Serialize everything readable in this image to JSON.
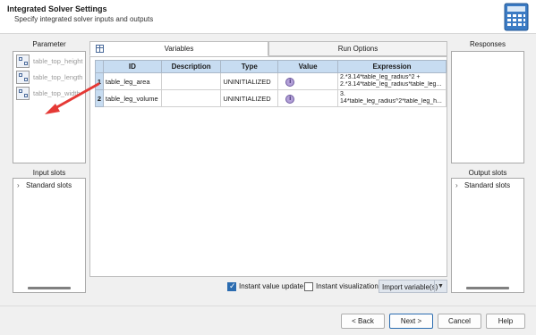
{
  "header": {
    "title": "Integrated Solver Settings",
    "subtitle": "Specify integrated solver inputs and outputs",
    "icon": "calculator-icon"
  },
  "parameter_panel": {
    "title": "Parameter",
    "items": [
      {
        "label": "table_top_height"
      },
      {
        "label": "table_top_length"
      },
      {
        "label": "table_top_width"
      }
    ]
  },
  "input_slots": {
    "title": "Input slots",
    "items": [
      {
        "label": "Standard slots"
      }
    ]
  },
  "responses_panel": {
    "title": "Responses"
  },
  "output_slots": {
    "title": "Output slots",
    "items": [
      {
        "label": "Standard slots"
      }
    ]
  },
  "tabs": [
    {
      "label": "Variables",
      "active": true
    },
    {
      "label": "Run Options",
      "active": false
    }
  ],
  "grid": {
    "columns": [
      "ID",
      "Description",
      "Type",
      "Value",
      "Expression"
    ],
    "rows": [
      {
        "num": "1",
        "id": "table_leg_area",
        "description": "",
        "type": "UNINITIALIZED",
        "value_icon": "info-icon",
        "expr_line1": "2.*3.14*table_leg_radius^2 +",
        "expr_line2": "2.*3.14*table_leg_radius*table_leg..."
      },
      {
        "num": "2",
        "id": "table_leg_volume",
        "description": "",
        "type": "UNINITIALIZED",
        "value_icon": "info-icon",
        "expr_line1": "3.",
        "expr_line2": "14*table_leg_radius^2*table_leg_h..."
      }
    ]
  },
  "options": {
    "instant_value_update": {
      "label": "Instant value update",
      "checked": true
    },
    "instant_visualization": {
      "label": "Instant visualization",
      "checked": false
    },
    "import_label": "Import variable(s)"
  },
  "buttons": {
    "back": "< Back",
    "next": "Next >",
    "cancel": "Cancel",
    "help": "Help"
  },
  "colors": {
    "grid_header": "#c7dcf1",
    "annotation_arrow": "#e53935"
  }
}
